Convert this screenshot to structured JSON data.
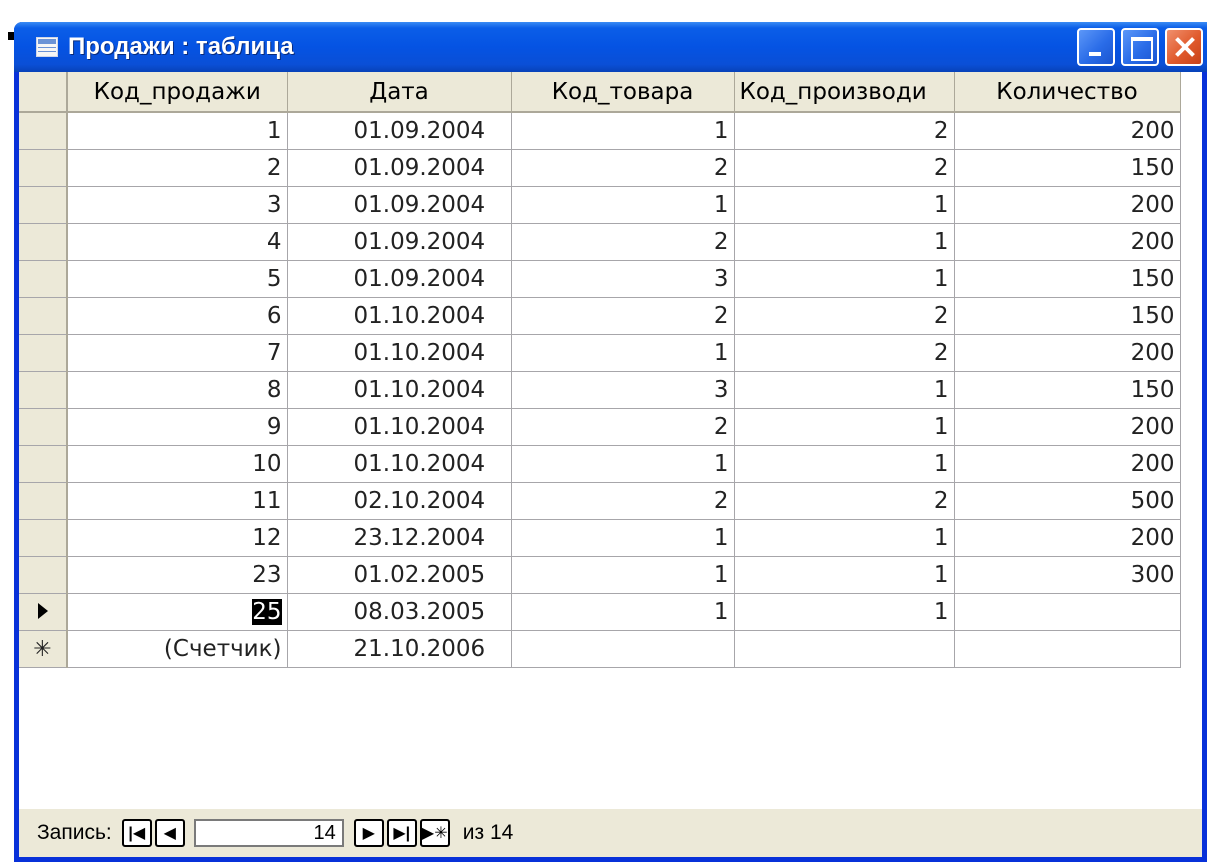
{
  "window": {
    "title": "Продажи : таблица"
  },
  "table": {
    "columns": [
      "Код_продажи",
      "Дата",
      "Код_товара",
      "Код_производи",
      "Количество"
    ],
    "rows": [
      {
        "id": "1",
        "date": "01.09.2004",
        "item": "1",
        "maker": "2",
        "qty": "200"
      },
      {
        "id": "2",
        "date": "01.09.2004",
        "item": "2",
        "maker": "2",
        "qty": "150"
      },
      {
        "id": "3",
        "date": "01.09.2004",
        "item": "1",
        "maker": "1",
        "qty": "200"
      },
      {
        "id": "4",
        "date": "01.09.2004",
        "item": "2",
        "maker": "1",
        "qty": "200"
      },
      {
        "id": "5",
        "date": "01.09.2004",
        "item": "3",
        "maker": "1",
        "qty": "150"
      },
      {
        "id": "6",
        "date": "01.10.2004",
        "item": "2",
        "maker": "2",
        "qty": "150"
      },
      {
        "id": "7",
        "date": "01.10.2004",
        "item": "1",
        "maker": "2",
        "qty": "200"
      },
      {
        "id": "8",
        "date": "01.10.2004",
        "item": "3",
        "maker": "1",
        "qty": "150"
      },
      {
        "id": "9",
        "date": "01.10.2004",
        "item": "2",
        "maker": "1",
        "qty": "200"
      },
      {
        "id": "10",
        "date": "01.10.2004",
        "item": "1",
        "maker": "1",
        "qty": "200"
      },
      {
        "id": "11",
        "date": "02.10.2004",
        "item": "2",
        "maker": "2",
        "qty": "500"
      },
      {
        "id": "12",
        "date": "23.12.2004",
        "item": "1",
        "maker": "1",
        "qty": "200"
      },
      {
        "id": "23",
        "date": "01.02.2005",
        "item": "1",
        "maker": "1",
        "qty": "300"
      }
    ],
    "current_row": {
      "id": "25",
      "date": "08.03.2005",
      "item": "1",
      "maker": "1",
      "qty": ""
    },
    "new_row": {
      "marker": "✳",
      "id": "(Счетчик)",
      "date": "21.10.2006"
    }
  },
  "navigation": {
    "label": "Запись:",
    "current": "14",
    "of_text": "из 14",
    "icons": [
      "first-record-icon",
      "prev-record-icon",
      "next-record-icon",
      "last-record-icon",
      "new-record-icon"
    ]
  },
  "colors": {
    "titlebar": "#0553e3",
    "window_border": "#0831d9",
    "chrome": "#ece9d8",
    "close_button": "#e05a2c"
  }
}
